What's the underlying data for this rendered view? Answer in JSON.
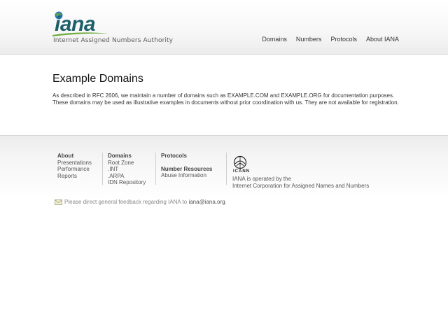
{
  "header": {
    "logo_text": "iana",
    "logo_tagline": "Internet Assigned Numbers Authority",
    "nav": [
      {
        "label": "Domains"
      },
      {
        "label": "Numbers"
      },
      {
        "label": "Protocols"
      },
      {
        "label": "About IANA"
      }
    ]
  },
  "main": {
    "title": "Example Domains",
    "paragraph": "As described in RFC 2606, we maintain a number of domains such as EXAMPLE.COM and EXAMPLE.ORG for documentation purposes. These domains may be used as illustrative examples in documents without prior coordination with us. They are not available for registration."
  },
  "footer": {
    "about": {
      "heading": "About",
      "links": [
        "Presentations",
        "Performance",
        "Reports"
      ]
    },
    "domains": {
      "heading": "Domains",
      "links": [
        "Root Zone",
        ".INT",
        ".ARPA",
        "IDN Repository"
      ]
    },
    "protocols": {
      "heading": "Protocols"
    },
    "number_resources": {
      "heading": "Number Resources",
      "links": [
        "Abuse Information"
      ]
    },
    "icann": {
      "logo_text": "ICANN",
      "line1": "IANA is operated by the",
      "line2": "Internet Corporation for Assigned Names and Numbers"
    },
    "feedback": {
      "text": "Please direct general feedback regarding IANA to",
      "email": "iana@iana.org",
      "suffix": "."
    }
  },
  "colors": {
    "logo_teal": "#1f5f6a",
    "logo_green": "#6cab3a",
    "logo_blue": "#2a7bb5"
  }
}
